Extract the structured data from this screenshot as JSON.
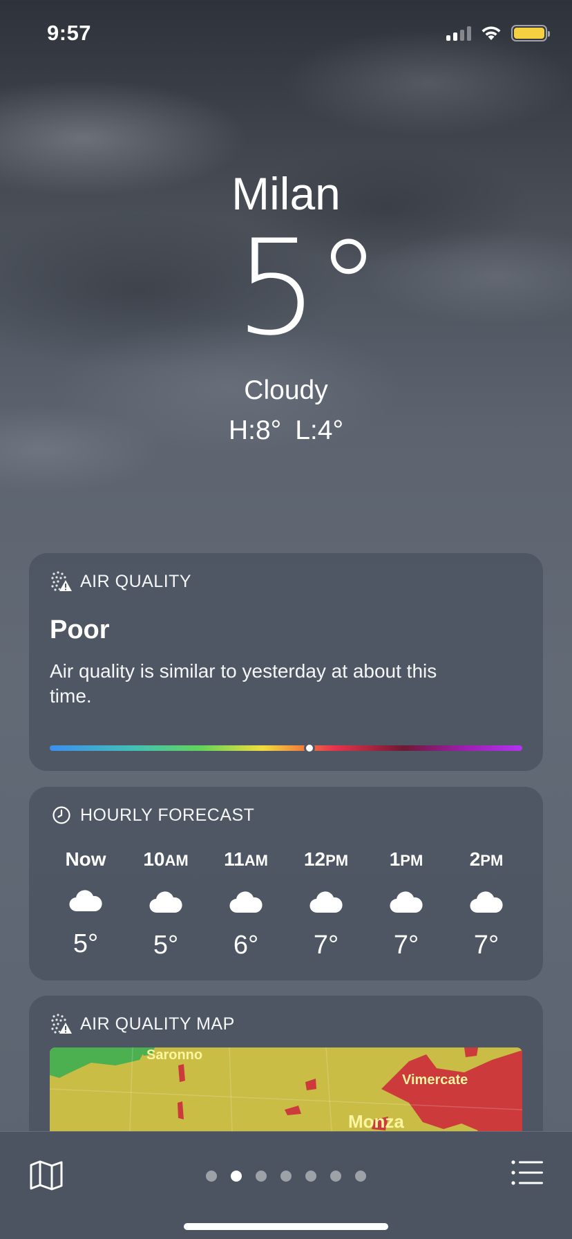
{
  "status_bar": {
    "time": "9:57",
    "icons": [
      "cellular-signal-icon",
      "wifi-icon",
      "battery-icon"
    ],
    "battery_color": "#f5d142"
  },
  "location": {
    "city": "Milan",
    "temperature": "5°",
    "condition": "Cloudy",
    "high": "H:8°",
    "low": "L:4°"
  },
  "air_quality": {
    "header": "AIR QUALITY",
    "level": "Poor",
    "description": "Air quality is similar to yesterday at about this time.",
    "index_fraction": 0.55,
    "icon": "air-quality-warning-icon"
  },
  "hourly": {
    "header": "HOURLY FORECAST",
    "icon": "clock-icon",
    "items": [
      {
        "time": "Now",
        "icon": "cloud-icon",
        "temp": "5°"
      },
      {
        "time": "10AM",
        "icon": "cloud-icon",
        "temp": "5°"
      },
      {
        "time": "11AM",
        "icon": "cloud-icon",
        "temp": "6°"
      },
      {
        "time": "12PM",
        "icon": "cloud-icon",
        "temp": "7°"
      },
      {
        "time": "1PM",
        "icon": "cloud-icon",
        "temp": "7°"
      },
      {
        "time": "2PM",
        "icon": "cloud-icon",
        "temp": "7°"
      }
    ]
  },
  "air_quality_map": {
    "header": "AIR QUALITY MAP",
    "places": [
      "Saronno",
      "Vimercate",
      "Monza"
    ],
    "colors": {
      "good": "#4caf50",
      "moderate": "#c9bd45",
      "poor": "#cc3a3c"
    }
  },
  "bottom_bar": {
    "page_count": 7,
    "active_page": 1,
    "left_icon": "map-icon",
    "right_icon": "list-icon"
  }
}
